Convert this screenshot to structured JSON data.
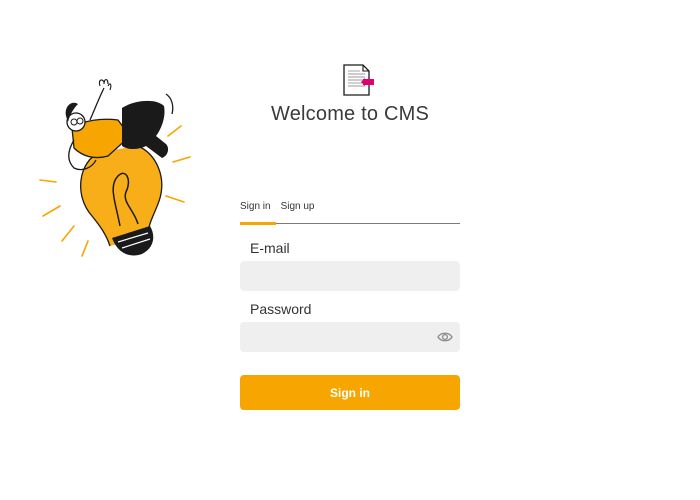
{
  "header": {
    "logo_icon": "document-icon",
    "title": "Welcome to CMS"
  },
  "tabs": [
    {
      "label": "Sign in",
      "active": true
    },
    {
      "label": "Sign up",
      "active": false
    }
  ],
  "form": {
    "email": {
      "label": "E-mail",
      "value": "",
      "placeholder": ""
    },
    "password": {
      "label": "Password",
      "value": "",
      "placeholder": "",
      "toggle_icon": "eye-icon"
    },
    "submit_label": "Sign in"
  },
  "colors": {
    "accent": "#f7a500",
    "input_bg": "#efefef",
    "logo_accent": "#e0006f"
  }
}
